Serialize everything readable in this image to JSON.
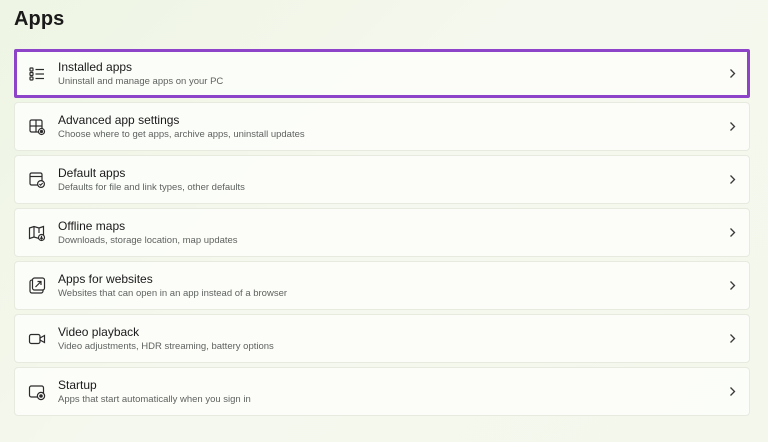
{
  "page": {
    "title": "Apps"
  },
  "settings": {
    "items": [
      {
        "id": "installed-apps",
        "title": "Installed apps",
        "subtitle": "Uninstall and manage apps on your PC",
        "icon": "list-icon",
        "highlighted": true
      },
      {
        "id": "advanced-app-settings",
        "title": "Advanced app settings",
        "subtitle": "Choose where to get apps, archive apps, uninstall updates",
        "icon": "app-settings-icon",
        "highlighted": false
      },
      {
        "id": "default-apps",
        "title": "Default apps",
        "subtitle": "Defaults for file and link types, other defaults",
        "icon": "default-apps-icon",
        "highlighted": false
      },
      {
        "id": "offline-maps",
        "title": "Offline maps",
        "subtitle": "Downloads, storage location, map updates",
        "icon": "map-icon",
        "highlighted": false
      },
      {
        "id": "apps-for-websites",
        "title": "Apps for websites",
        "subtitle": "Websites that can open in an app instead of a browser",
        "icon": "open-in-app-icon",
        "highlighted": false
      },
      {
        "id": "video-playback",
        "title": "Video playback",
        "subtitle": "Video adjustments, HDR streaming, battery options",
        "icon": "video-camera-icon",
        "highlighted": false
      },
      {
        "id": "startup",
        "title": "Startup",
        "subtitle": "Apps that start automatically when you sign in",
        "icon": "startup-icon",
        "highlighted": false
      }
    ]
  },
  "colors": {
    "highlight_border": "#8e44c8",
    "card_background": "#fcfdfa",
    "page_background": "#f1f6e9"
  }
}
